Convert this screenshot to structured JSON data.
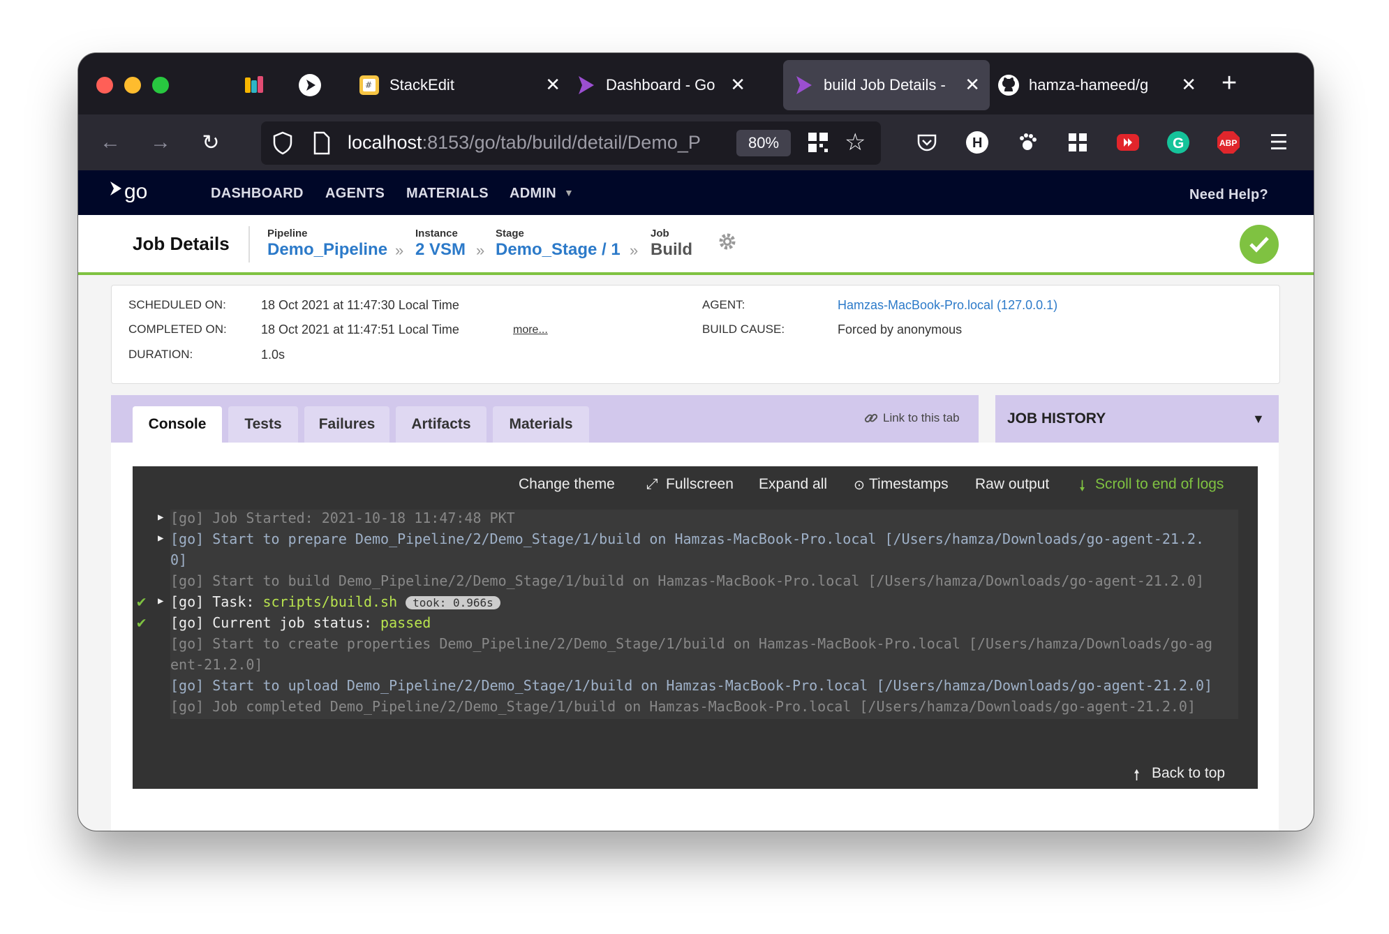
{
  "browser": {
    "tabs": [
      {
        "title": "StackEdit",
        "active": false
      },
      {
        "title": "Dashboard - Go",
        "active": false
      },
      {
        "title": "build Job Details -",
        "active": true
      },
      {
        "title": "hamza-hameed/g",
        "active": false
      }
    ],
    "url_host": "localhost",
    "url_rest": ":8153/go/tab/build/detail/Demo_P",
    "zoom": "80%"
  },
  "gocd": {
    "nav": [
      "DASHBOARD",
      "AGENTS",
      "MATERIALS",
      "ADMIN"
    ],
    "help": "Need Help?"
  },
  "page": {
    "title": "Job Details",
    "pipeline_label": "Pipeline",
    "pipeline": "Demo_Pipeline",
    "instance_label": "Instance",
    "instance": "2 VSM",
    "stage_label": "Stage",
    "stage": "Demo_Stage / 1",
    "job_label": "Job",
    "job": "Build"
  },
  "info": {
    "scheduled_label": "SCHEDULED ON:",
    "scheduled": "18 Oct 2021 at 11:47:30 Local Time",
    "completed_label": "COMPLETED ON:",
    "completed": "18 Oct 2021 at 11:47:51 Local Time",
    "more": "more...",
    "duration_label": "DURATION:",
    "duration": "1.0s",
    "agent_label": "AGENT:",
    "agent": "Hamzas-MacBook-Pro.local (127.0.0.1)",
    "cause_label": "BUILD CAUSE:",
    "cause": "Forced by anonymous"
  },
  "tabs": [
    "Console",
    "Tests",
    "Failures",
    "Artifacts",
    "Materials"
  ],
  "link_tab": "Link to this tab",
  "job_history": "JOB HISTORY",
  "console": {
    "toolbar": {
      "theme": "Change theme",
      "fullscreen": "Fullscreen",
      "expand": "Expand all",
      "timestamps": "Timestamps",
      "raw": "Raw output",
      "scroll": "Scroll to end of logs"
    },
    "lines": {
      "l1": "[go] Job Started: 2021-10-18 11:47:48 PKT",
      "l2a": "[go] Start to prepare Demo_Pipeline/2/Demo_Stage/1/build on Hamzas-MacBook-Pro.local [/Users/hamza/Downloads/go-agent-21.2.",
      "l2b": "0]",
      "l3": "[go] Start to build Demo_Pipeline/2/Demo_Stage/1/build on Hamzas-MacBook-Pro.local [/Users/hamza/Downloads/go-agent-21.2.0]",
      "l4_prefix": "[go] Task: ",
      "l4_task": "scripts/build.sh",
      "l4_took": "took: 0.966s",
      "l5_prefix": "[go] Current job status: ",
      "l5_status": "passed",
      "l6a": "[go] Start to create properties Demo_Pipeline/2/Demo_Stage/1/build on Hamzas-MacBook-Pro.local [/Users/hamza/Downloads/go-ag",
      "l6b": "ent-21.2.0]",
      "l7": "[go] Start to upload Demo_Pipeline/2/Demo_Stage/1/build on Hamzas-MacBook-Pro.local [/Users/hamza/Downloads/go-agent-21.2.0]",
      "l8": "[go] Job completed Demo_Pipeline/2/Demo_Stage/1/build on Hamzas-MacBook-Pro.local [/Users/hamza/Downloads/go-agent-21.2.0]"
    },
    "back_to_top": "Back to top"
  },
  "colors": {
    "accent": "#2c7ac9",
    "success": "#7fc241",
    "header": "#000728",
    "tabs_bg": "#d2c8ec"
  }
}
